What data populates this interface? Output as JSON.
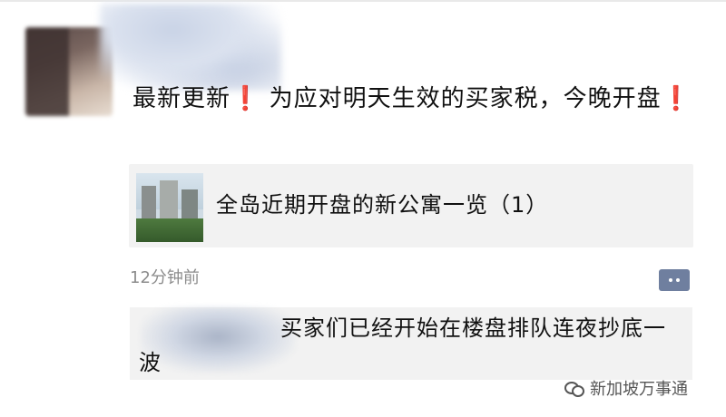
{
  "post": {
    "author_avatar": "avatar",
    "text_part1": "最新更新",
    "exclamation": "❗",
    "text_part2": "为应对明天生效的买家税，今晚开盘",
    "link_card": {
      "title": "全岛近期开盘的新公寓一览（1）",
      "thumbnail": "apartment-buildings-image"
    },
    "timestamp": "12分钟前",
    "comment_icon": "comment-icon"
  },
  "comment": {
    "text": "买家们已经开始在楼盘排队连夜抄底一波"
  },
  "watermark": {
    "icon": "wechat-icon",
    "text": "新加坡万事通"
  },
  "colors": {
    "exclamation": "#e03a33",
    "comment_button": "#6f7f9f",
    "card_bg": "#f2f2f2",
    "timestamp": "#8c8c8c"
  }
}
